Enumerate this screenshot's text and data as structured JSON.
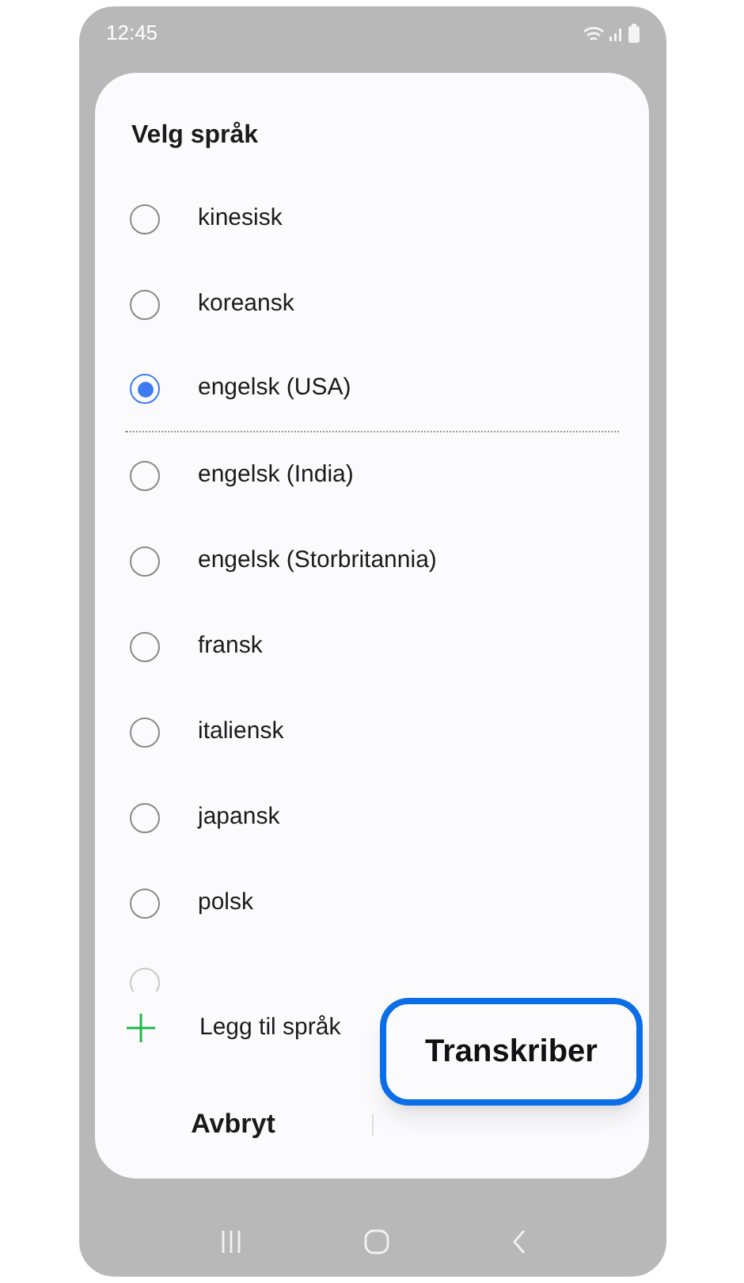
{
  "status_bar": {
    "time": "12:45"
  },
  "dialog": {
    "title": "Velg språk",
    "languages": [
      {
        "label": "kinesisk",
        "selected": false,
        "divider_below": false
      },
      {
        "label": "koreansk",
        "selected": false,
        "divider_below": false
      },
      {
        "label": "engelsk (USA)",
        "selected": true,
        "divider_below": true
      },
      {
        "label": "engelsk (India)",
        "selected": false,
        "divider_below": false
      },
      {
        "label": "engelsk (Storbritannia)",
        "selected": false,
        "divider_below": false
      },
      {
        "label": "fransk",
        "selected": false,
        "divider_below": false
      },
      {
        "label": "italiensk",
        "selected": false,
        "divider_below": false
      },
      {
        "label": "japansk",
        "selected": false,
        "divider_below": false
      },
      {
        "label": "polsk",
        "selected": false,
        "divider_below": false
      }
    ],
    "partial_option": {
      "selected": false
    },
    "add_language": "Legg til språk",
    "buttons": [
      {
        "label": "Avbryt",
        "highlighted": false
      },
      {
        "label": "Transkriber",
        "highlighted": true
      }
    ]
  }
}
